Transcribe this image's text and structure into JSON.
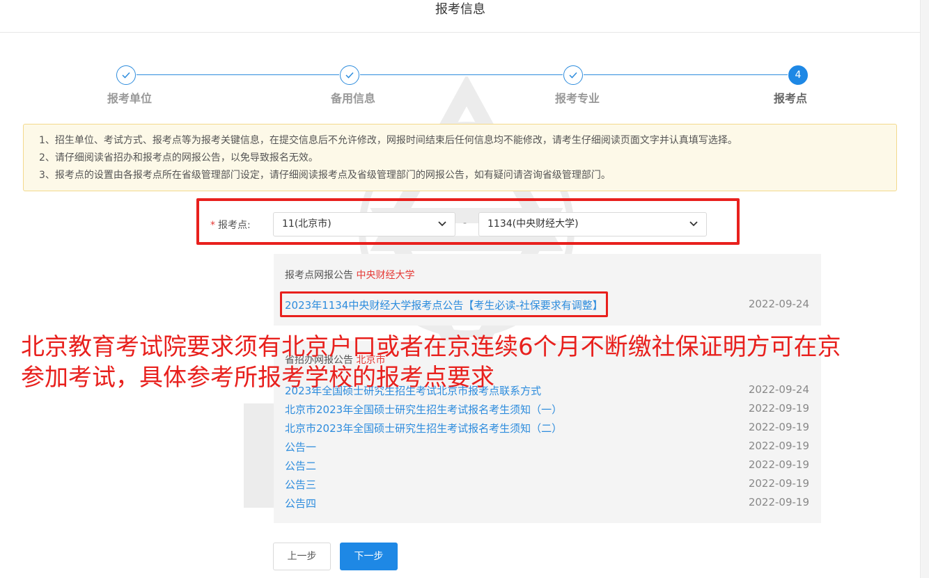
{
  "header": {
    "title": "报考信息"
  },
  "steps": [
    {
      "label": "报考单位",
      "state": "done"
    },
    {
      "label": "备用信息",
      "state": "done"
    },
    {
      "label": "报考专业",
      "state": "done"
    },
    {
      "label": "报考点",
      "state": "active",
      "number": "4"
    }
  ],
  "notice": [
    "1、招生单位、考试方式、报考点等为报考关键信息，在提交信息后不允许修改，网报时间结束后任何信息均不能修改，请考生仔细阅读页面文字并认真填写选择。",
    "2、请仔细阅读省招办和报考点的网报公告，以免导致报名无效。",
    "3、报考点的设置由各报考点所在省级管理部门设定，请仔细阅读报考点及省级管理部门的网报公告，如有疑问请咨询省级管理部门。"
  ],
  "form": {
    "required_mark": "*",
    "label": "报考点:",
    "province_select": "11(北京市)",
    "separator": "-",
    "site_select": "1134(中央财经大学)"
  },
  "site_announcements": {
    "heading": "报考点网报公告",
    "highlight": "中央财经大学",
    "items": [
      {
        "title": "2023年1134中央财经大学报考点公告【考生必读-社保要求有调整】",
        "date": "2022-09-24"
      }
    ]
  },
  "province_announcements": {
    "heading": "省招办网报公告",
    "highlight": "北京市",
    "items": [
      {
        "title": "2023年全国硕士研究生招生考试北京市报考点联系方式",
        "date": "2022-09-24"
      },
      {
        "title": "北京市2023年全国硕士研究生招生考试报名考生须知（一）",
        "date": "2022-09-19"
      },
      {
        "title": "北京市2023年全国硕士研究生招生考试报名考生须知（二）",
        "date": "2022-09-19"
      },
      {
        "title": "公告一",
        "date": "2022-09-19"
      },
      {
        "title": "公告二",
        "date": "2022-09-19"
      },
      {
        "title": "公告三",
        "date": "2022-09-19"
      },
      {
        "title": "公告四",
        "date": "2022-09-19"
      }
    ]
  },
  "overlay": {
    "line1": "北京教育考试院要求须有北京户口或者在京连续6个月不断缴社保证明方可在京",
    "line2": "参加考试，具体参考所报考学校的报考点要求"
  },
  "buttons": {
    "prev": "上一步",
    "next": "下一步"
  },
  "colors": {
    "accent": "#1e88e5",
    "highlight": "#e8201d",
    "notice_bg": "#fdf9e8"
  }
}
